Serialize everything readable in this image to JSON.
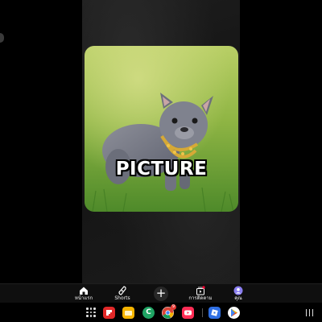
{
  "video": {
    "caption": "PICTURE"
  },
  "bottom_nav": {
    "items": [
      {
        "icon": "home-icon",
        "label": "หน้าแรก"
      },
      {
        "icon": "shorts-icon",
        "label": "Shorts"
      },
      {
        "icon": "plus-icon",
        "label": "+"
      },
      {
        "icon": "subscriptions-icon",
        "label": "การติดตาม"
      },
      {
        "icon": "avatar-icon",
        "label": "คุณ"
      }
    ]
  },
  "taskbar": {
    "apps": [
      {
        "name": "flipboard-app-icon",
        "color": "#e12828",
        "glyph": ""
      },
      {
        "name": "folder-app-icon",
        "color": "#f6b400",
        "glyph": ""
      },
      {
        "name": "phone-app-icon",
        "color": "#1fa463",
        "glyph": "C"
      },
      {
        "name": "chrome-app-icon",
        "color": "#4285f4",
        "glyph": "",
        "badge": "9"
      },
      {
        "name": "youtube-app-icon",
        "color": "#ff2d55",
        "glyph": ""
      },
      {
        "name": "roblox-app-icon",
        "color": "#2f6fe4",
        "glyph": ""
      },
      {
        "name": "play-store-app-icon",
        "color": "#ffffff",
        "glyph": ""
      }
    ]
  },
  "colors": {
    "nav_bg": "#0f0f0f",
    "video_bg": "#181818"
  }
}
